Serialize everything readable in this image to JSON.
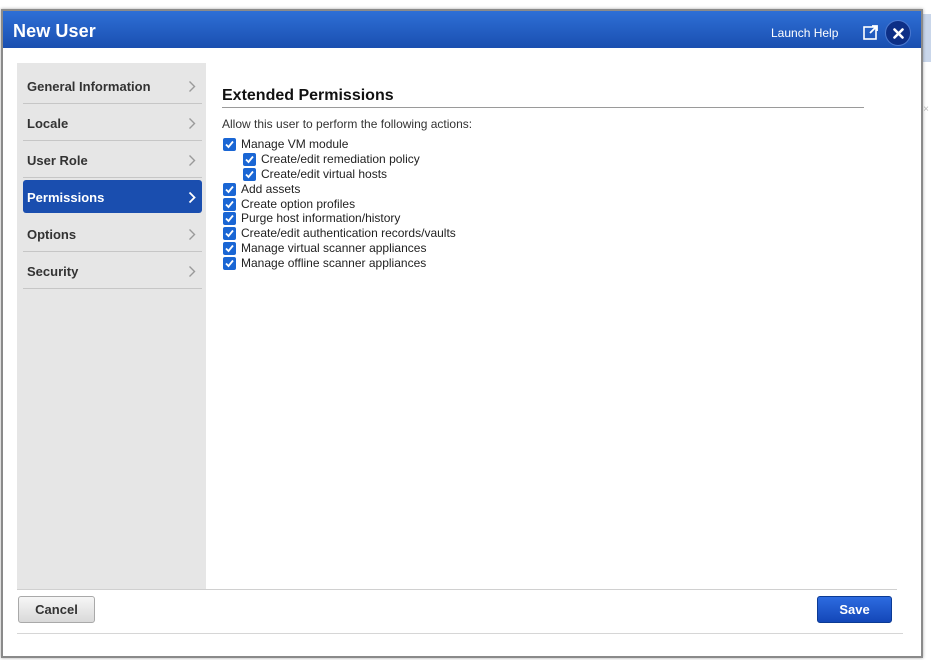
{
  "dialog": {
    "title": "New User",
    "launch_help": "Launch Help"
  },
  "sidebar": {
    "items": [
      {
        "label": "General Information",
        "active": false
      },
      {
        "label": "Locale",
        "active": false
      },
      {
        "label": "User Role",
        "active": false
      },
      {
        "label": "Permissions",
        "active": true
      },
      {
        "label": "Options",
        "active": false
      },
      {
        "label": "Security",
        "active": false
      }
    ]
  },
  "permissions": {
    "heading": "Extended Permissions",
    "intro": "Allow this user to perform the following actions:",
    "items": [
      {
        "label": "Manage VM module",
        "checked": true,
        "indent": 0
      },
      {
        "label": "Create/edit remediation policy",
        "checked": true,
        "indent": 1
      },
      {
        "label": "Create/edit virtual hosts",
        "checked": true,
        "indent": 1
      },
      {
        "label": "Add assets",
        "checked": true,
        "indent": 0
      },
      {
        "label": "Create option profiles",
        "checked": true,
        "indent": 0
      },
      {
        "label": "Purge host information/history",
        "checked": true,
        "indent": 0
      },
      {
        "label": "Create/edit authentication records/vaults",
        "checked": true,
        "indent": 0
      },
      {
        "label": "Manage virtual scanner appliances",
        "checked": true,
        "indent": 0
      },
      {
        "label": "Manage offline scanner appliances",
        "checked": true,
        "indent": 0
      }
    ]
  },
  "footer": {
    "cancel_label": "Cancel",
    "save_label": "Save"
  },
  "colors": {
    "titlebar": "#1a4fb0",
    "active_item": "#1a4eaf",
    "checkbox": "#1a66d4"
  }
}
